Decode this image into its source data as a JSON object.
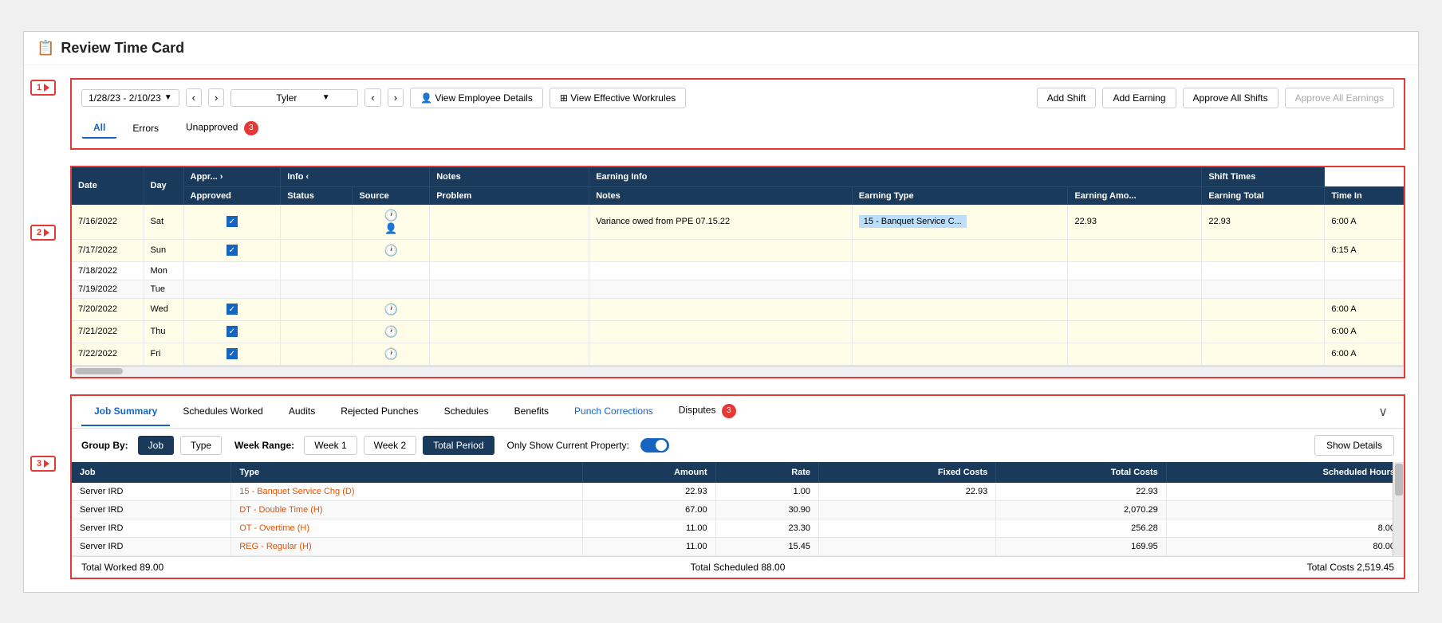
{
  "page": {
    "title": "Review Time Card",
    "icon": "📋"
  },
  "toolbar": {
    "date_range": "1/28/23 - 2/10/23",
    "employee_name": "Tyler",
    "view_employee_label": "View Employee Details",
    "view_workrules_label": "View Effective Workrules",
    "add_shift_label": "Add Shift",
    "add_earning_label": "Add Earning",
    "approve_all_shifts_label": "Approve All Shifts",
    "approve_all_earnings_label": "Approve All Earnings"
  },
  "filters": {
    "all_label": "All",
    "errors_label": "Errors",
    "unapproved_label": "Unapproved",
    "unapproved_count": "3"
  },
  "timecard_table": {
    "col_headers_top": [
      {
        "label": ""
      },
      {
        "label": "Appr..."
      },
      {
        "label": "Info <"
      },
      {
        "label": ""
      },
      {
        "label": ""
      },
      {
        "label": "Notes"
      },
      {
        "label": "Earning Info"
      },
      {
        "label": ""
      },
      {
        "label": ""
      },
      {
        "label": "Shift Times"
      }
    ],
    "col_headers_sub": [
      {
        "label": "Date"
      },
      {
        "label": "Day"
      },
      {
        "label": "Approved"
      },
      {
        "label": "Status"
      },
      {
        "label": "Source"
      },
      {
        "label": "Problem"
      },
      {
        "label": "Notes"
      },
      {
        "label": "Earning Type"
      },
      {
        "label": "Earning Amo..."
      },
      {
        "label": "Earning Total"
      },
      {
        "label": "Time In"
      }
    ],
    "rows": [
      {
        "date": "7/16/2022",
        "day": "Sat",
        "approved": true,
        "status": "",
        "source": "clock",
        "problem": "",
        "notes": "Variance owed from PPE 07.15.22",
        "earning_type": "15 - Banquet Service C...",
        "earning_amt": "22.93",
        "earning_total": "22.93",
        "time_in": "6:00 A",
        "highlight": true,
        "has_person": true
      },
      {
        "date": "7/17/2022",
        "day": "Sun",
        "approved": true,
        "status": "",
        "source": "clock",
        "problem": "",
        "notes": "",
        "earning_type": "",
        "earning_amt": "",
        "earning_total": "",
        "time_in": "6:15 A",
        "highlight": true,
        "has_person": false
      },
      {
        "date": "7/18/2022",
        "day": "Mon",
        "approved": false,
        "status": "",
        "source": "",
        "problem": "",
        "notes": "",
        "earning_type": "",
        "earning_amt": "",
        "earning_total": "",
        "time_in": "",
        "highlight": false,
        "has_person": false
      },
      {
        "date": "7/19/2022",
        "day": "Tue",
        "approved": false,
        "status": "",
        "source": "",
        "problem": "",
        "notes": "",
        "earning_type": "",
        "earning_amt": "",
        "earning_total": "",
        "time_in": "",
        "highlight": false,
        "has_person": false
      },
      {
        "date": "7/20/2022",
        "day": "Wed",
        "approved": true,
        "status": "",
        "source": "clock",
        "problem": "",
        "notes": "",
        "earning_type": "",
        "earning_amt": "",
        "earning_total": "",
        "time_in": "6:00 A",
        "highlight": true,
        "has_person": false
      },
      {
        "date": "7/21/2022",
        "day": "Thu",
        "approved": true,
        "status": "",
        "source": "clock",
        "problem": "",
        "notes": "",
        "earning_type": "",
        "earning_amt": "",
        "earning_total": "",
        "time_in": "6:00 A",
        "highlight": true,
        "has_person": false
      },
      {
        "date": "7/22/2022",
        "day": "Fri",
        "approved": true,
        "status": "",
        "source": "clock",
        "problem": "",
        "notes": "",
        "earning_type": "",
        "earning_amt": "",
        "earning_total": "",
        "time_in": "6:00 A",
        "highlight": true,
        "has_person": false
      }
    ]
  },
  "bottom_tabs": {
    "tabs": [
      {
        "label": "Job Summary",
        "active": true,
        "link": false
      },
      {
        "label": "Schedules Worked",
        "active": false,
        "link": false
      },
      {
        "label": "Audits",
        "active": false,
        "link": false
      },
      {
        "label": "Rejected Punches",
        "active": false,
        "link": false
      },
      {
        "label": "Schedules",
        "active": false,
        "link": false
      },
      {
        "label": "Benefits",
        "active": false,
        "link": false
      },
      {
        "label": "Punch Corrections",
        "active": false,
        "link": true
      },
      {
        "label": "Disputes",
        "active": false,
        "link": false,
        "badge": "3"
      }
    ]
  },
  "job_summary": {
    "group_by_label": "Group By:",
    "group_job_label": "Job",
    "group_type_label": "Type",
    "week_range_label": "Week Range:",
    "week1_label": "Week 1",
    "week2_label": "Week 2",
    "total_period_label": "Total Period",
    "only_show_label": "Only Show Current Property:",
    "show_details_label": "Show Details",
    "col_headers": [
      "Job",
      "Type",
      "Amount",
      "Rate",
      "Fixed Costs",
      "Total Costs",
      "Scheduled Hours"
    ],
    "rows": [
      {
        "job": "Server IRD",
        "type": "15 - Banquet Service Chg (D)",
        "amount": "22.93",
        "rate": "1.00",
        "fixed_costs": "22.93",
        "total_costs": "22.93",
        "scheduled_hours": ""
      },
      {
        "job": "Server IRD",
        "type": "DT - Double Time (H)",
        "amount": "67.00",
        "rate": "30.90",
        "fixed_costs": "",
        "total_costs": "2,070.29",
        "scheduled_hours": ""
      },
      {
        "job": "Server IRD",
        "type": "OT - Overtime (H)",
        "amount": "11.00",
        "rate": "23.30",
        "fixed_costs": "",
        "total_costs": "256.28",
        "scheduled_hours": "8.00"
      },
      {
        "job": "Server IRD",
        "type": "REG - Regular (H)",
        "amount": "11.00",
        "rate": "15.45",
        "fixed_costs": "",
        "total_costs": "169.95",
        "scheduled_hours": "80.00"
      }
    ],
    "footer": {
      "total_worked": "Total Worked 89.00",
      "total_scheduled": "Total Scheduled 88.00",
      "total_costs": "Total Costs 2,519.45"
    }
  },
  "steps": [
    {
      "label": "1"
    },
    {
      "label": "2"
    },
    {
      "label": "3"
    }
  ]
}
